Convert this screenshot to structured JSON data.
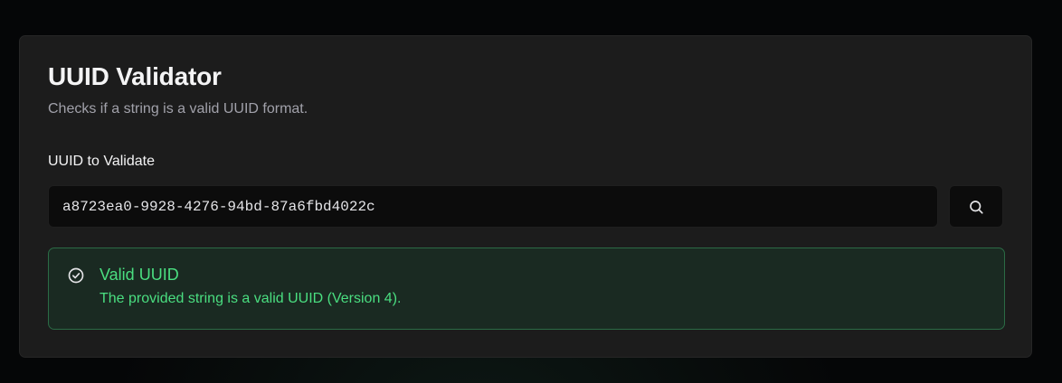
{
  "validator": {
    "title": "UUID Validator",
    "subtitle": "Checks if a string is a valid UUID format."
  },
  "input": {
    "label": "UUID to Validate",
    "value": "a8723ea0-9928-4276-94bd-87a6fbd4022c",
    "button_icon": "search-icon"
  },
  "result": {
    "status": "valid",
    "icon": "check-circle-icon",
    "title": "Valid UUID",
    "description": "The provided string is a valid UUID (Version 4).",
    "color": "#4ade80"
  },
  "colors": {
    "page_background": "#050607",
    "card_background": "#1c1c1c",
    "input_background": "#0c0c0c",
    "success_background": "#1a2a22",
    "success_border": "#2b6b45",
    "success_text": "#4ade80"
  }
}
